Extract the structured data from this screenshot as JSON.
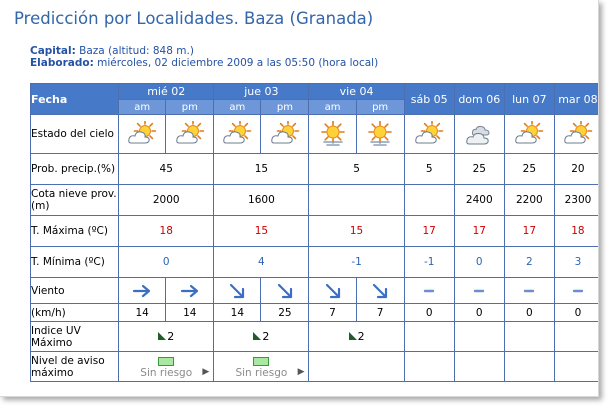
{
  "title": "Predicción por Localidades. Baza (Granada)",
  "capital_label": "Capital:",
  "capital_value": "Baza (altitud: 848 m.)",
  "elaborado_label": "Elaborado:",
  "elaborado_value": "miércoles, 02 diciembre 2009 a las 05:50 (hora local)",
  "table": {
    "header_label": "Fecha",
    "split_days": [
      "mié 02",
      "jue 03",
      "vie 04"
    ],
    "single_days": [
      "sáb 05",
      "dom 06",
      "lun 07",
      "mar 08"
    ],
    "am_label": "am",
    "pm_label": "pm",
    "rows": {
      "estado": {
        "label": "Estado del cielo",
        "icons": [
          "partly-cloudy-sun-icon",
          "partly-cloudy-sun-icon",
          "partly-cloudy-sun-icon",
          "partly-cloudy-sun-icon",
          "sun-haze-icon",
          "sun-haze-icon",
          "partly-cloudy-sun-icon",
          "cloudy-icon",
          "partly-cloudy-sun-icon",
          "partly-cloudy-sun-icon"
        ]
      },
      "prob": {
        "label": "Prob. precip.(%)",
        "values": [
          "45",
          "15",
          "5",
          "5",
          "25",
          "25",
          "20"
        ]
      },
      "cota": {
        "label": "Cota nieve prov.(m)",
        "values": [
          "2000",
          "1600",
          "",
          "",
          "2400",
          "2200",
          "2300"
        ]
      },
      "tmax": {
        "label": "T. Máxima (ºC)",
        "values": [
          "18",
          "15",
          "15",
          "17",
          "17",
          "17",
          "18"
        ],
        "color": "#cc0000"
      },
      "tmin": {
        "label": "T. Mínima (ºC)",
        "values": [
          "0",
          "4",
          "-1",
          "-1",
          "0",
          "2",
          "3"
        ],
        "color": "#2e63b8"
      },
      "viento": {
        "label": "Viento",
        "icons": [
          "arrow-east-icon",
          "arrow-east-icon",
          "arrow-southeast-icon",
          "arrow-southeast-icon",
          "arrow-southeast-icon",
          "arrow-southeast-icon",
          "calm-dash-icon",
          "calm-dash-icon",
          "calm-dash-icon",
          "calm-dash-icon"
        ]
      },
      "kmh": {
        "label": "(km/h)",
        "values": [
          "14",
          "14",
          "14",
          "25",
          "7",
          "7",
          "0",
          "0",
          "0",
          "0"
        ]
      },
      "uv": {
        "label": "Indice UV Máximo",
        "values": [
          "2",
          "2",
          "2",
          "",
          "",
          "",
          ""
        ]
      },
      "aviso": {
        "label": "Nivel de aviso máximo",
        "values": [
          "Sin riesgo",
          "Sin riesgo",
          "",
          "",
          "",
          "",
          ""
        ]
      }
    }
  },
  "colors": {
    "title": "#3366aa",
    "header_bg": "#4679c7",
    "subheader_bg": "#6d97d8",
    "grid": "#4d6fb0",
    "wind_arrow": "#3a6fc4"
  }
}
